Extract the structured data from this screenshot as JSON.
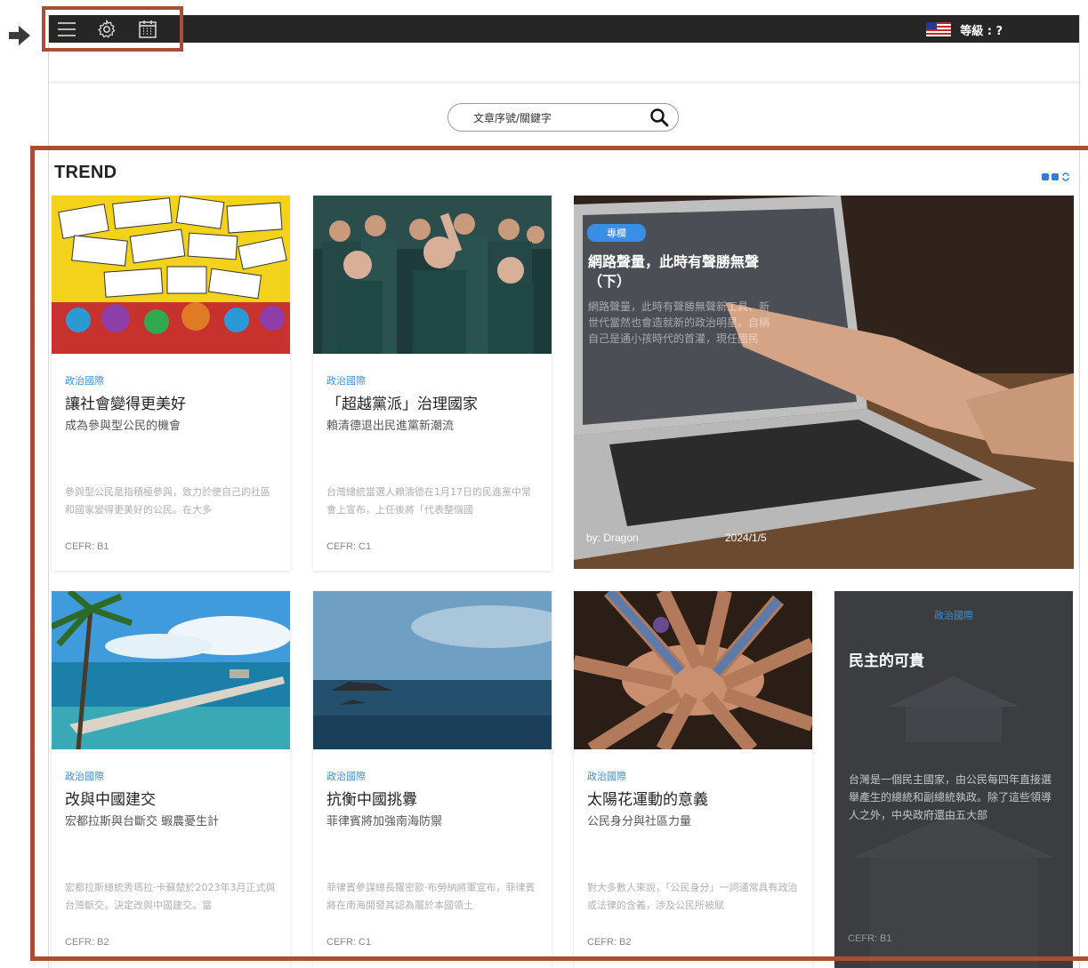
{
  "topbar": {
    "menu_icon": "hamburger-menu-icon",
    "settings_icon": "gear-icon",
    "calendar_icon": "calendar-icon",
    "flag_icon": "us-flag-icon",
    "level_label": "等級 : ?"
  },
  "search": {
    "placeholder": "文章序號/關鍵字",
    "icon": "search-icon"
  },
  "section": {
    "title": "TREND",
    "view_toggle_icon": "grid-view-icon"
  },
  "featured": {
    "tag": "專欄",
    "title": "網路聲量，此時有聲勝無聲（下）",
    "excerpt": "網路聲量，此時有聲勝無聲新工具、新世代當然也會造就新的政治明星。自稱自己是通小孩時代的首灌，現任國民",
    "author": "by: Dragon",
    "date": "2024/1/5"
  },
  "cards": [
    {
      "image": "protest-signs-illustration",
      "category": "政治國際",
      "title": "讓社會變得更美好",
      "subtitle": "成為參與型公民的機會",
      "excerpt": "參與型公民是指積極參與，致力於使自己的社區和國家變得更美好的公民。在大多",
      "cefr": "CEFR: B1"
    },
    {
      "image": "election-rally-photo",
      "category": "政治國際",
      "title": "「超越黨派」治理國家",
      "subtitle": "賴清德退出民進黨新潮流",
      "excerpt": "台灣總統當選人賴清德在1月17日的民進黨中常會上宣布，上任後將「代表整個國",
      "cefr": "CEFR: C1"
    },
    {
      "image": "pier-tropical-beach-photo",
      "category": "政治國際",
      "title": "改與中國建交",
      "subtitle": "宏都拉斯與台斷交 蝦農憂生計",
      "excerpt": "宏都拉斯總統秀瑪拉·卡蘇楚於2023年3月正式與台灣斷交，決定改與中國建交。當",
      "cefr": "CEFR: B2"
    },
    {
      "image": "sea-rocks-photo",
      "category": "政治國際",
      "title": "抗衡中國挑釁",
      "subtitle": "菲律賓將加強南海防禦",
      "excerpt": "菲律賓參謀總長羅密歐·布勞納將軍宣布，菲律賓將在南海開發其認為屬於本國領土",
      "cefr": "CEFR: C1"
    },
    {
      "image": "stacked-hands-photo",
      "category": "政治國際",
      "title": "太陽花運動的意義",
      "subtitle": "公民身分與社區力量",
      "excerpt": "對大多數人來說，「公民身分」一詞通常具有政治或法律的含義，涉及公民所被賦",
      "cefr": "CEFR: B2"
    }
  ],
  "dark_card": {
    "category": "政治國際",
    "title": "民主的可貴",
    "excerpt": "台灣是一個民主國家，由公民每四年直接選舉產生的總統和副總統執政。除了這些領導人之外，中央政府還由五大部",
    "cefr": "CEFR: B1"
  },
  "colors": {
    "topbar": "#262626",
    "accent": "#3a8fd8",
    "highlight": "#a84d38",
    "dark_card": "#3b3d40"
  }
}
